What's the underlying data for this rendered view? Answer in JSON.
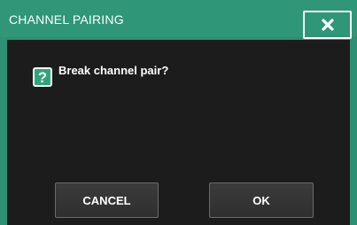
{
  "dialog": {
    "title": "CHANNEL PAIRING",
    "close_icon": "close-icon",
    "message": "Break channel pair?",
    "question_icon": "question-icon",
    "question_glyph": "?",
    "cancel_label": "CANCEL",
    "ok_label": "OK"
  },
  "colors": {
    "title_bar": "#2f9677",
    "frame": "#2d8f73",
    "body_background": "#1c1c1c",
    "question_icon_background": "#2fa47c",
    "button_background": "#353535"
  }
}
